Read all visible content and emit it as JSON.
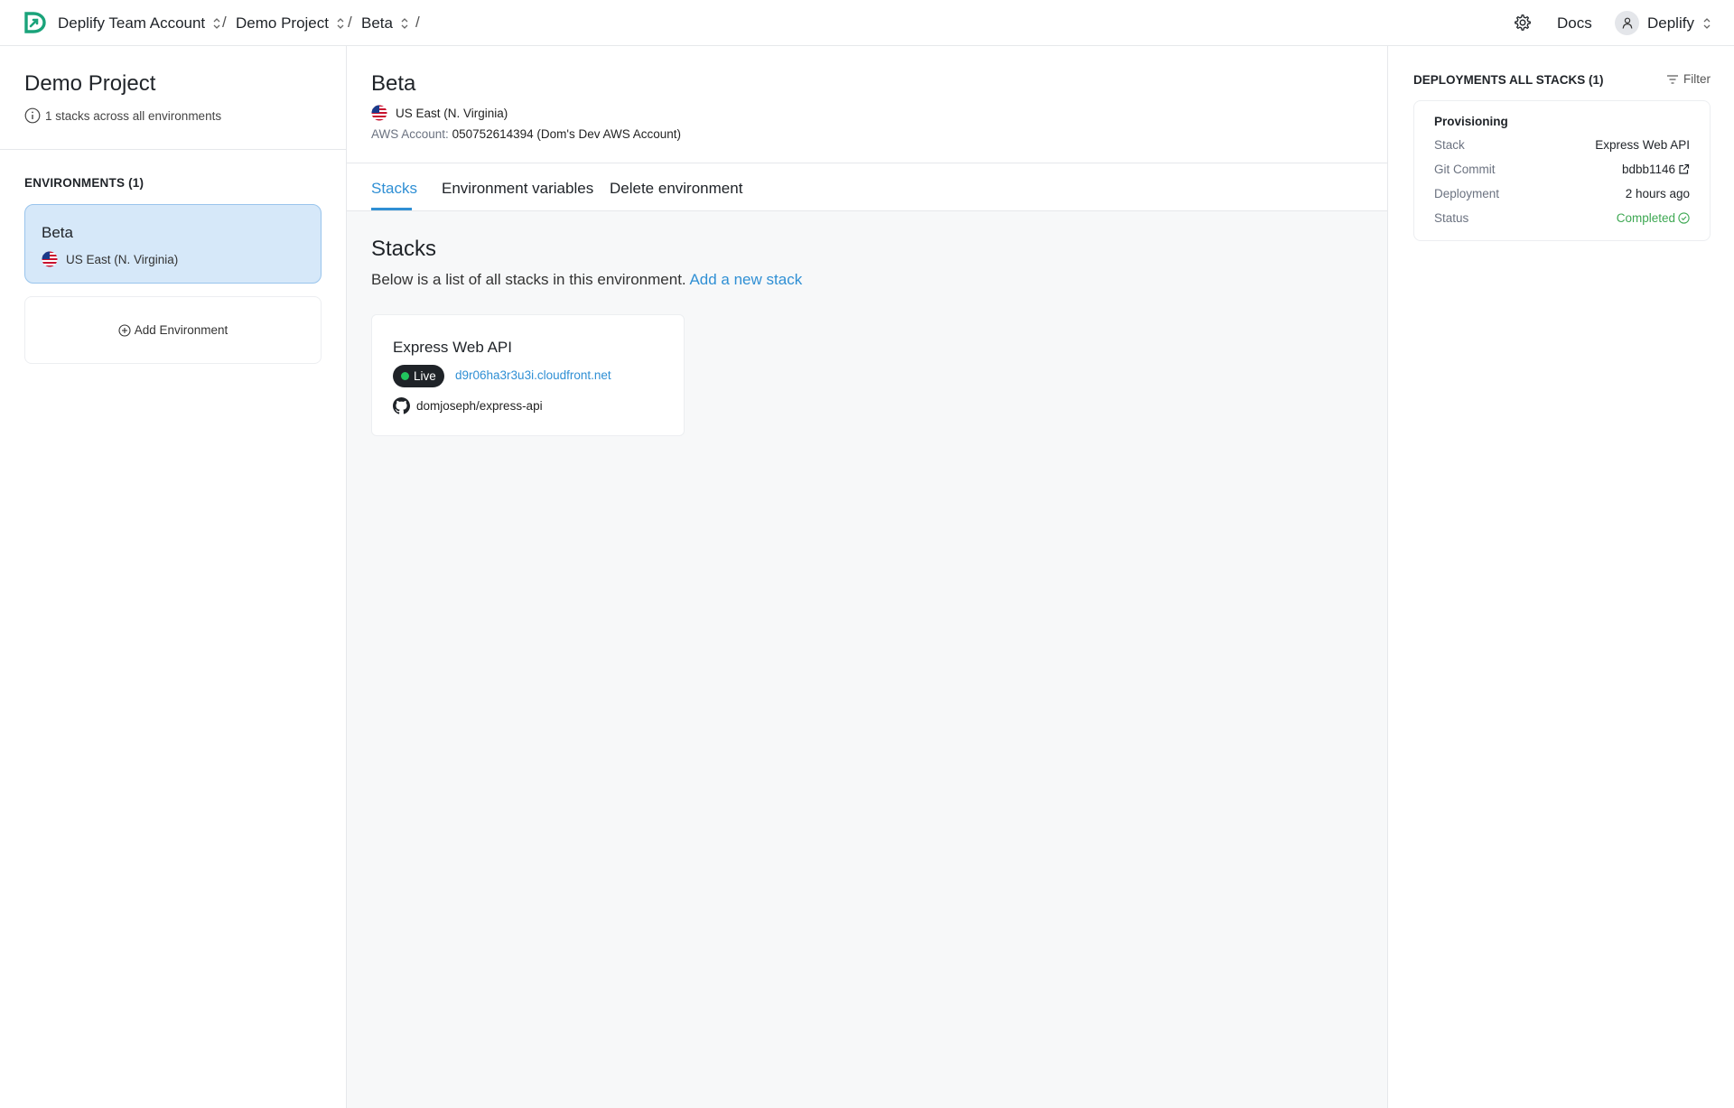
{
  "breadcrumb": {
    "account": "Deplify Team Account",
    "project": "Demo Project",
    "environment": "Beta",
    "separator": "/"
  },
  "header": {
    "docs": "Docs",
    "user": "Deplify"
  },
  "sidebar": {
    "project_title": "Demo Project",
    "project_summary": "1 stacks across all environments",
    "environments_heading": "ENVIRONMENTS (1)",
    "environments": [
      {
        "name": "Beta",
        "region": "US East (N. Virginia)"
      }
    ],
    "add_environment": "Add Environment"
  },
  "environment": {
    "title": "Beta",
    "region": "US East (N. Virginia)",
    "aws_label": "AWS Account:",
    "aws_value": "050752614394 (Dom's Dev AWS Account)"
  },
  "tabs": [
    {
      "label": "Stacks",
      "active": true
    },
    {
      "label": "Environment variables",
      "active": false
    },
    {
      "label": "Delete environment",
      "active": false
    }
  ],
  "stacks": {
    "heading": "Stacks",
    "description": "Below is a list of all stacks in this environment.",
    "add_link": "Add a new stack",
    "items": [
      {
        "name": "Express Web API",
        "status": "Live",
        "url": "d9r06ha3r3u3i.cloudfront.net",
        "repo": "domjoseph/express-api"
      }
    ]
  },
  "deployments": {
    "heading": "DEPLOYMENTS ALL STACKS (1)",
    "filter": "Filter",
    "items": [
      {
        "state": "Provisioning",
        "rows": [
          {
            "key": "Stack",
            "value": "Express Web API"
          },
          {
            "key": "Git Commit",
            "value": "bdbb1146"
          },
          {
            "key": "Deployment",
            "value": "2 hours ago"
          },
          {
            "key": "Status",
            "value": "Completed"
          }
        ]
      }
    ]
  },
  "colors": {
    "accent": "#2f8fd4",
    "brand": "#1aa37a",
    "selected_bg": "#d6e8f9",
    "success": "#3ea853"
  }
}
